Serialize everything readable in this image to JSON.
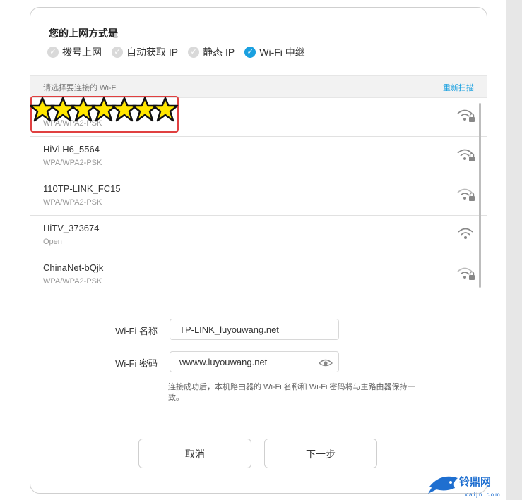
{
  "header": {
    "title": "您的上网方式是"
  },
  "modes": [
    {
      "label": "拨号上网",
      "selected": false
    },
    {
      "label": "自动获取 IP",
      "selected": false
    },
    {
      "label": "静态 IP",
      "selected": false
    },
    {
      "label": "Wi-Fi 中继",
      "selected": true
    }
  ],
  "list_header": {
    "hint": "请选择要连接的 Wi-Fi",
    "rescan": "重新扫描"
  },
  "wifi_networks": [
    {
      "ssid": "",
      "security": "WPA/WPA2-PSK",
      "signal": "wifi-locked-icon"
    },
    {
      "ssid": "HiVi H6_5564",
      "security": "WPA/WPA2-PSK",
      "signal": "wifi-locked-icon"
    },
    {
      "ssid": "110TP-LINK_FC15",
      "security": "WPA/WPA2-PSK",
      "signal": "wifi-locked-icon"
    },
    {
      "ssid": "HiTV_373674",
      "security": "Open",
      "signal": "wifi-open-icon"
    },
    {
      "ssid": "ChinaNet-bQjk",
      "security": "WPA/WPA2-PSK",
      "signal": "wifi-locked-icon"
    }
  ],
  "form": {
    "name_label": "Wi-Fi 名称",
    "name_value": "TP-LINK_luyouwang.net",
    "password_label": "Wi-Fi 密码",
    "password_value": "wwww.luyouwang.net",
    "note": "连接成功后，本机路由器的 Wi-Fi 名称和 Wi-Fi 密码将与主路由器保持一致。"
  },
  "buttons": {
    "cancel": "取消",
    "next": "下一步"
  },
  "watermark": {
    "text": "铃鼎网",
    "domain": "xaijn.com"
  },
  "colors": {
    "accent": "#1aa0e0",
    "highlight": "#e04040",
    "star_fill": "#ffe600"
  }
}
